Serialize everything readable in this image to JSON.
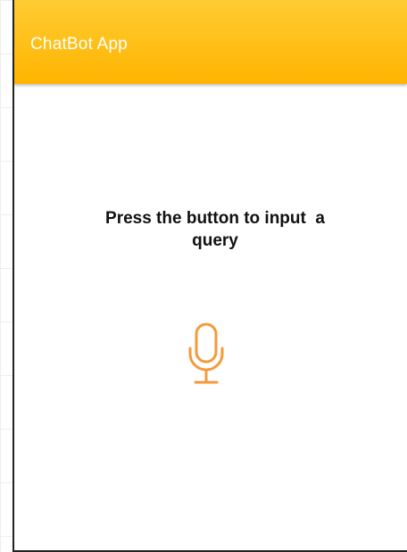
{
  "app": {
    "title": "ChatBot App",
    "accent_color": "#ffb400",
    "icon_color": "#f59a3c"
  },
  "main": {
    "prompt_line1": "Press the button to input  a",
    "prompt_line2": "query",
    "mic_icon": "microphone-icon"
  }
}
